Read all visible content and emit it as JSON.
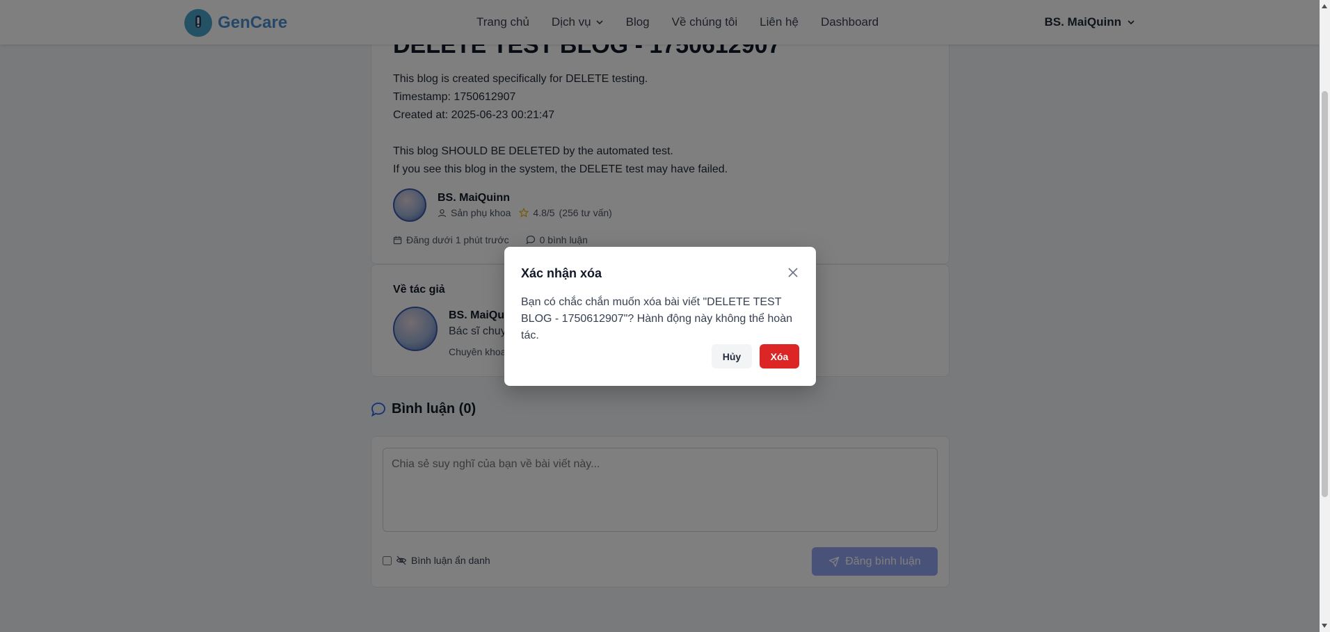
{
  "brand": {
    "name": "GenCare",
    "accent": "#4aa3c8"
  },
  "nav": {
    "items": [
      {
        "label": "Trang chủ"
      },
      {
        "label": "Dịch vụ",
        "dropdown": true
      },
      {
        "label": "Blog"
      },
      {
        "label": "Về chúng tôi"
      },
      {
        "label": "Liên hệ"
      },
      {
        "label": "Dashboard"
      }
    ],
    "user": "BS. MaiQuinn"
  },
  "article": {
    "title": "DELETE TEST BLOG - 1750612907",
    "lines": [
      "This blog is created specifically for DELETE testing.",
      "Timestamp: 1750612907",
      "Created at: 2025-06-23 00:21:47",
      "",
      "This blog SHOULD BE DELETED by the automated test.",
      "If you see this blog in the system, the DELETE test may have failed."
    ],
    "author": {
      "name": "BS. MaiQuinn",
      "specialty": "Sản phụ khoa",
      "rating": "4.8/5",
      "consults": "(256 tư vấn)"
    },
    "posted": "Đăng dưới 1 phút trước",
    "comment_count": "0 bình luận"
  },
  "about": {
    "heading": "Về tác giả",
    "name": "BS. MaiQui",
    "desc": "Bác sĩ chuyê",
    "spec": "Chuyên khoa"
  },
  "comments": {
    "title": "Bình luận (0)",
    "placeholder": "Chia sẻ suy nghĩ của bạn về bài viết này...",
    "anonymous_label": "Bình luận ẩn danh",
    "submit_label": "Đăng bình luận"
  },
  "modal": {
    "title": "Xác nhận xóa",
    "message": "Bạn có chắc chắn muốn xóa bài viết \"DELETE TEST BLOG - 1750612907\"? Hành động này không thể hoàn tác.",
    "cancel_label": "Hủy",
    "delete_label": "Xóa",
    "delete_color": "#dc2626"
  }
}
